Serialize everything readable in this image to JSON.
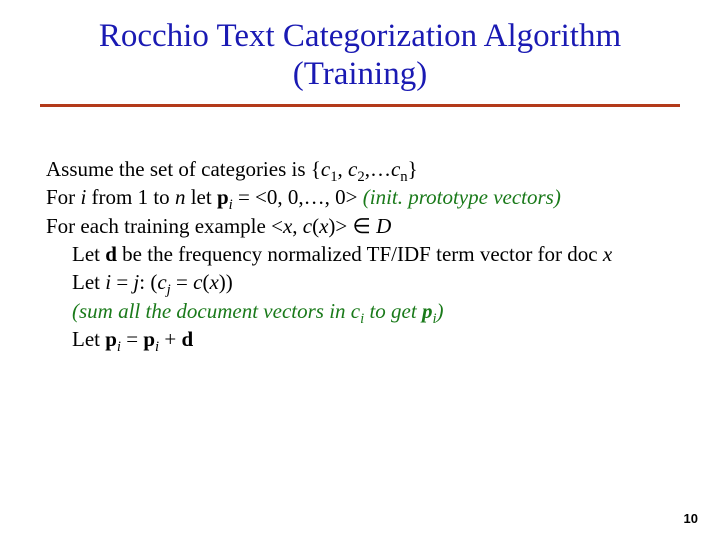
{
  "title": {
    "line1": "Rocchio Text Categorization Algorithm",
    "line2": "(Training)"
  },
  "body": {
    "l1_a": "Assume the set of categories is {",
    "l1_c1": "c",
    "l1_s1": "1",
    "l1_comma1": ", ",
    "l1_c2": "c",
    "l1_s2": "2",
    "l1_comma2": ",…",
    "l1_c3": "c",
    "l1_s3": "n",
    "l1_b": "}",
    "l2_a": "For ",
    "l2_i": "i",
    "l2_b": " from 1 to ",
    "l2_n": "n",
    "l2_c": " let ",
    "l2_p": "p",
    "l2_pi": "i",
    "l2_d": " = <0, 0,…, 0>  ",
    "l2_green": "(init. prototype vectors)",
    "l3_a": "For each training example <",
    "l3_x": "x",
    "l3_b": ", ",
    "l3_cx_c": "c",
    "l3_cx_p": "(",
    "l3_cx_x": "x",
    "l3_cx_q": ")",
    "l3_c": "> ∈ ",
    "l3_D": "D",
    "l4_a": "Let ",
    "l4_d": "d",
    "l4_b": " be the frequency normalized TF/IDF term vector for doc ",
    "l4_x": "x",
    "l5_a": "Let ",
    "l5_i": "i",
    "l5_b": " =  ",
    "l5_j": "j",
    "l5_c": ": (",
    "l5_cj_c": "c",
    "l5_cj_j": "j",
    "l5_eq": " = ",
    "l5_cx_c": "c",
    "l5_cx_p": "(",
    "l5_cx_x": "x",
    "l5_cx_q": ")",
    "l5_d": ")",
    "l6_a": "(sum all the document vectors in c",
    "l6_i": "i",
    "l6_b": " to get ",
    "l6_p": "p",
    "l6_pi": "i",
    "l6_c": ")",
    "l7_a": "Let ",
    "l7_p1": "p",
    "l7_i1": "i",
    "l7_eq": " = ",
    "l7_p2": "p",
    "l7_i2": "i",
    "l7_plus": " + ",
    "l7_d": "d"
  },
  "pagenum": "10"
}
